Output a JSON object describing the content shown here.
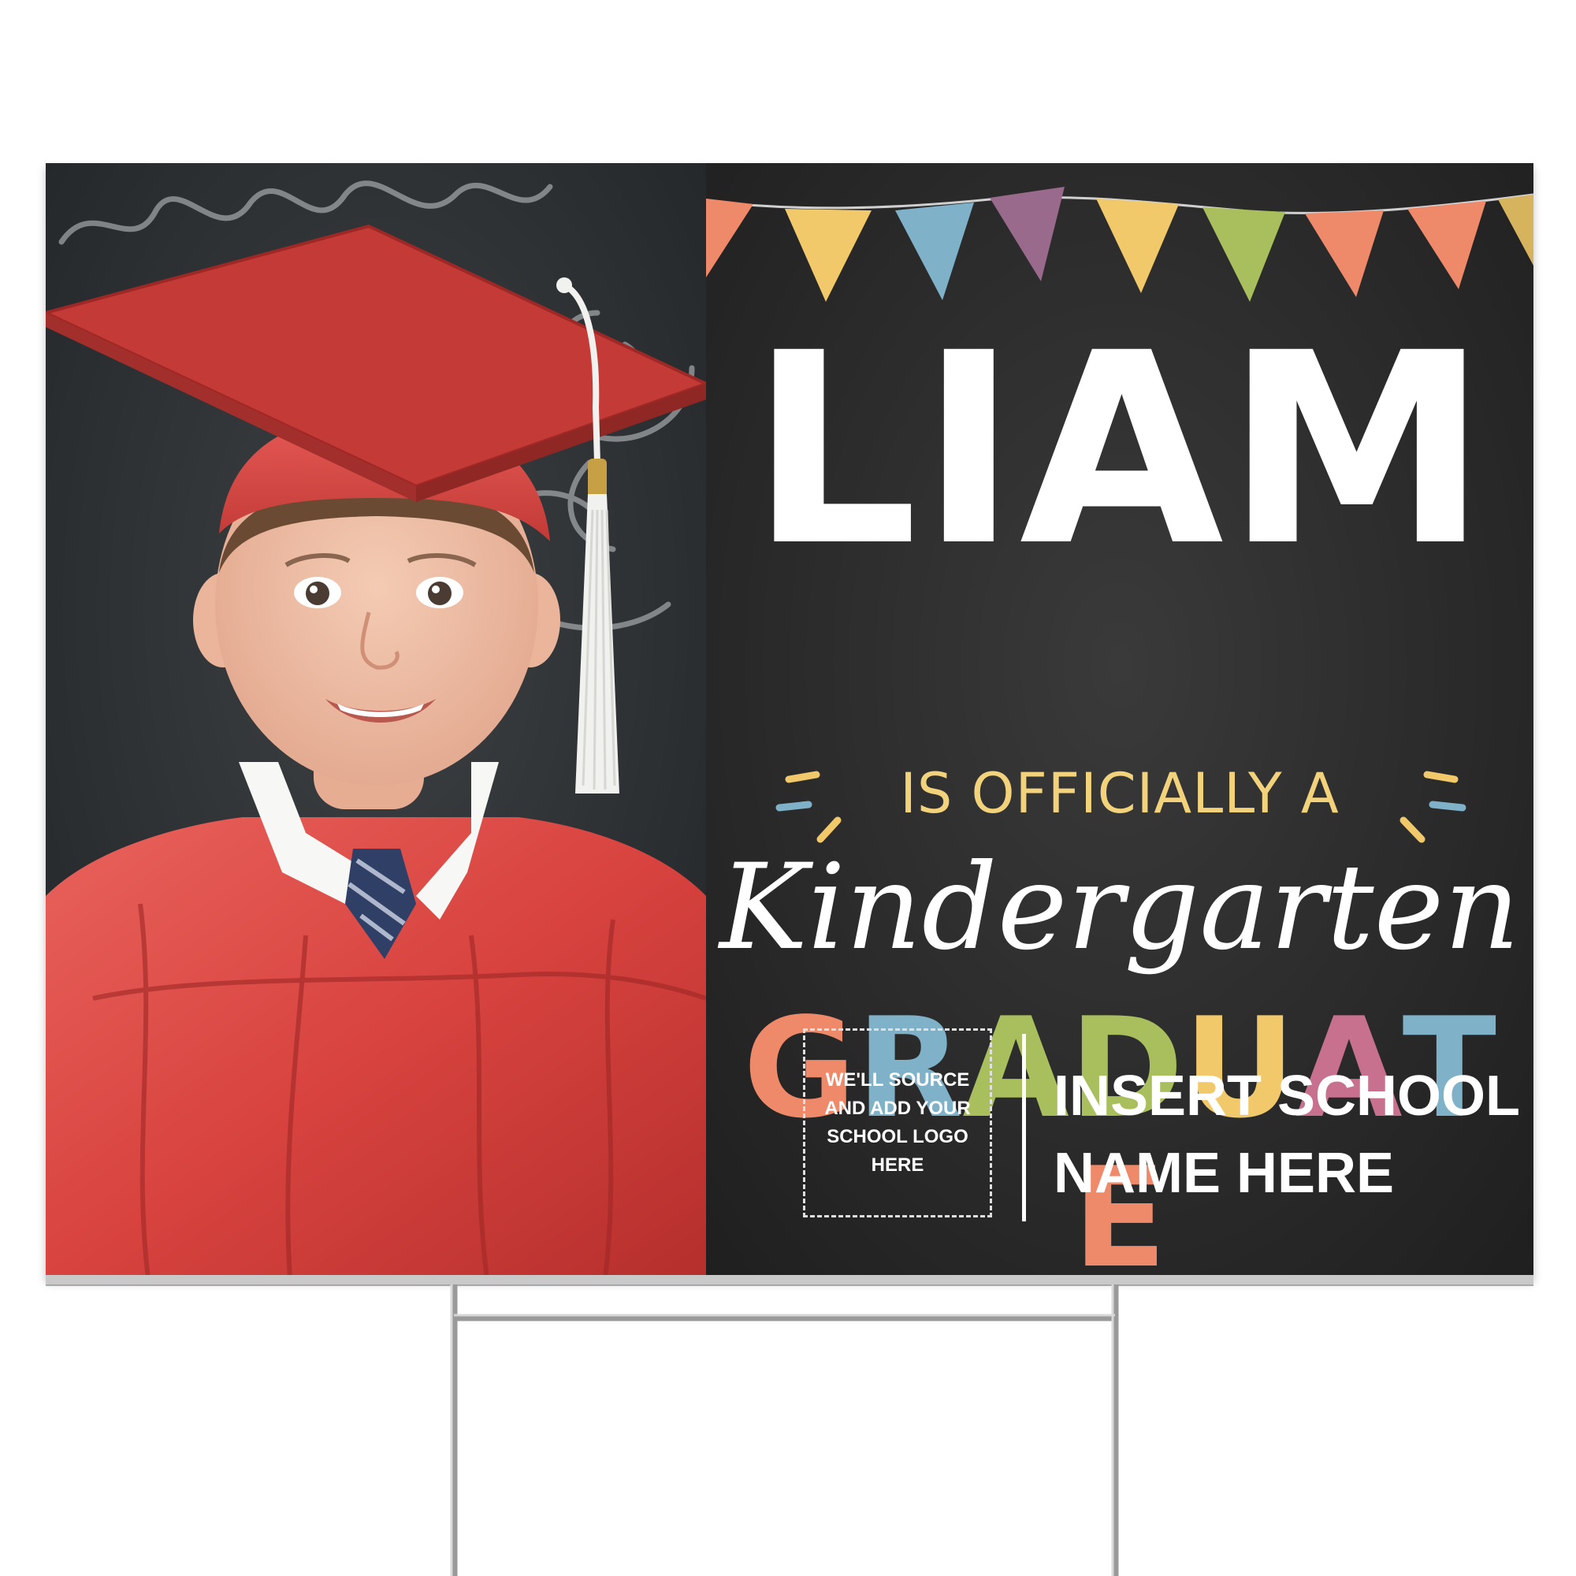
{
  "sign": {
    "name": "LIAM",
    "tagline": "IS OFFICIALLY A",
    "script_word": "Kindergarten",
    "graduate_letters": [
      {
        "letter": "G",
        "color": "#ee8a6a"
      },
      {
        "letter": "R",
        "color": "#7fb2c8"
      },
      {
        "letter": "A",
        "color": "#a9bf5e"
      },
      {
        "letter": "D",
        "color": "#a9bf5e"
      },
      {
        "letter": "U",
        "color": "#f2c96a"
      },
      {
        "letter": "A",
        "color": "#c7718e"
      },
      {
        "letter": "T",
        "color": "#7fb2c8"
      },
      {
        "letter": "E",
        "color": "#ee8a6a"
      }
    ],
    "logo_placeholder": "WE'LL SOURCE\nAND ADD YOUR\nSCHOOL LOGO\nHERE",
    "school_name": "INSERT SCHOOL\nNAME HERE"
  },
  "colors": {
    "chalkboard": "#2b2b2b",
    "tagline": "#f3d27c",
    "bunting": [
      "#ee8a6a",
      "#f2c96a",
      "#7fb2c8",
      "#9a6a8c",
      "#f2c96a",
      "#a9bf5e",
      "#ee8a6a",
      "#d6b45e"
    ],
    "gown": "#d8433f"
  },
  "icons": {
    "photo": "graduate-child-photo",
    "bunting": "pennant-banner-icon",
    "sparkles": "sparkle-lines-icon",
    "stake": "wire-h-stake-icon"
  }
}
